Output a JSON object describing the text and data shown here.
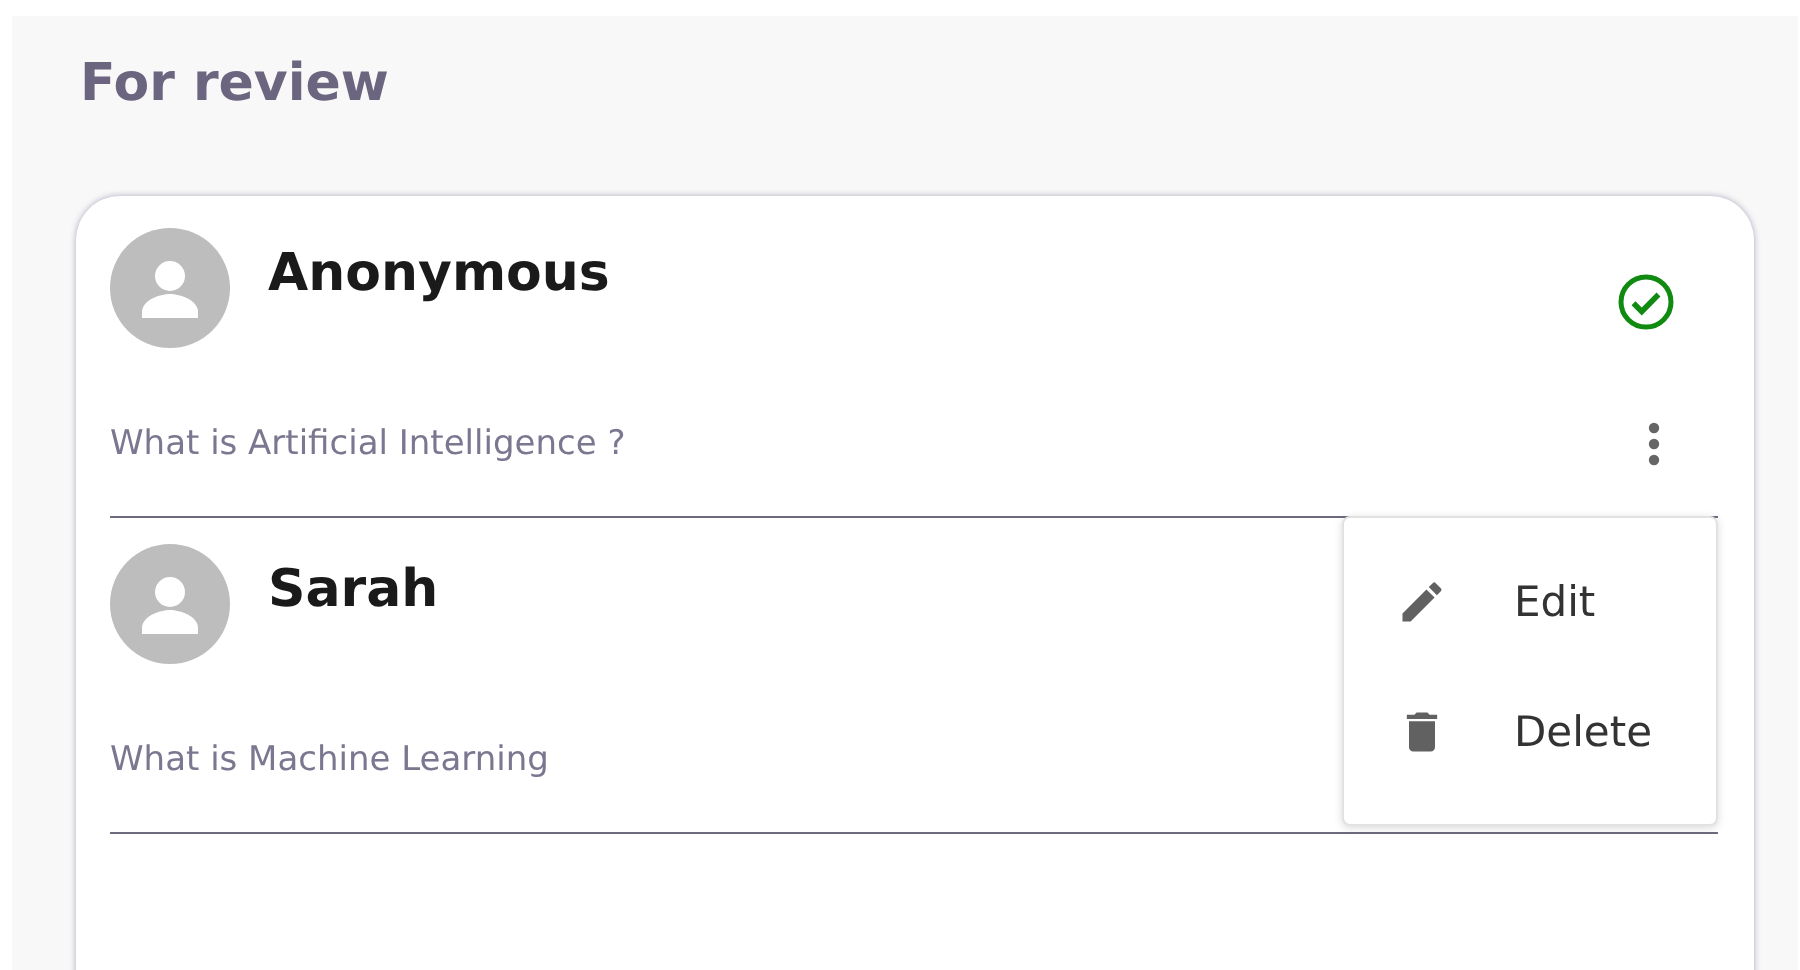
{
  "heading": "For review",
  "items": [
    {
      "name": "Anonymous",
      "question": "What is Artificial Intelligence ?",
      "reviewed": true,
      "menu_button": true
    },
    {
      "name": "Sarah",
      "question": "What is Machine Learning",
      "reviewed": false,
      "menu_button": false
    }
  ],
  "context_menu": {
    "items": [
      {
        "kind": "edit",
        "label": "Edit"
      },
      {
        "kind": "delete",
        "label": "Delete"
      }
    ]
  }
}
